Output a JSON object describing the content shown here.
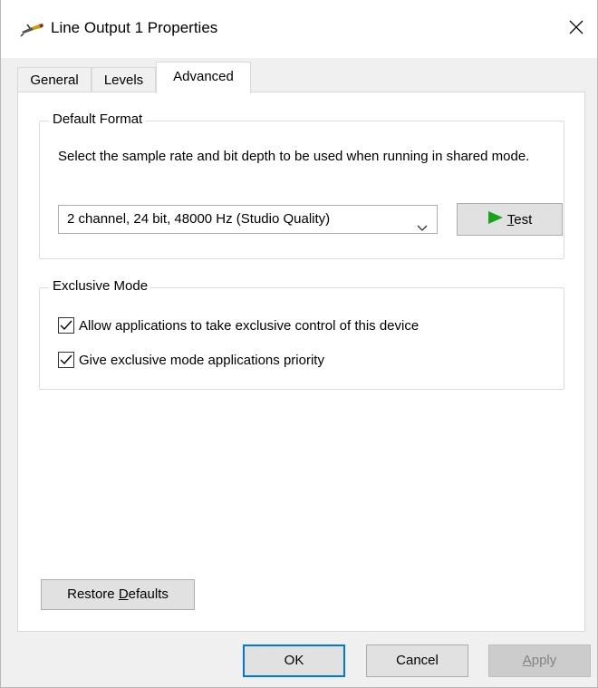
{
  "window": {
    "title": "Line Output 1 Properties",
    "close_glyph": "✕"
  },
  "tabs": [
    {
      "label": "General",
      "active": false
    },
    {
      "label": "Levels",
      "active": false
    },
    {
      "label": "Advanced",
      "active": true
    }
  ],
  "default_format": {
    "group_label": "Default Format",
    "description": "Select the sample rate and bit depth to be used when running in shared mode.",
    "selected_format": "2 channel, 24 bit, 48000 Hz (Studio Quality)",
    "test_label_pre": "",
    "test_label_accel": "T",
    "test_label_post": "est"
  },
  "exclusive_mode": {
    "group_label": "Exclusive Mode",
    "allow_exclusive_label": "Allow applications to take exclusive control of this device",
    "allow_exclusive_checked": true,
    "priority_label": "Give exclusive mode applications priority",
    "priority_checked": true
  },
  "restore": {
    "label_pre": "Restore ",
    "label_accel": "D",
    "label_post": "efaults"
  },
  "buttons": {
    "ok": "OK",
    "cancel": "Cancel",
    "apply_accel": "A",
    "apply_post": "pply"
  },
  "colors": {
    "test_arrow": "#1aa31a",
    "ok_border": "#0078d7"
  }
}
